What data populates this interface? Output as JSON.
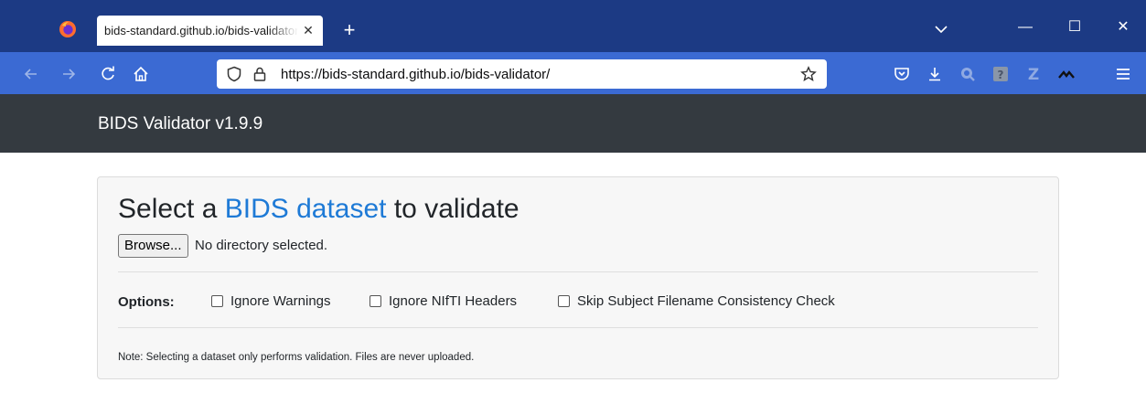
{
  "browser": {
    "tab_title": "bids-standard.github.io/bids-validator/",
    "url_host": "https://bids-standard.github.io",
    "url_path": "/bids-validator/"
  },
  "app": {
    "brand": "BIDS Validator v1.9.9"
  },
  "main": {
    "title_prefix": "Select a ",
    "title_link": "BIDS dataset",
    "title_suffix": " to validate",
    "browse_label": "Browse...",
    "browse_status": "No directory selected.",
    "options_label": "Options:",
    "options": [
      {
        "label": "Ignore Warnings",
        "checked": false
      },
      {
        "label": "Ignore NIfTI Headers",
        "checked": false
      },
      {
        "label": "Skip Subject Filename Consistency Check",
        "checked": false
      }
    ],
    "note": "Note: Selecting a dataset only performs validation. Files are never uploaded."
  },
  "colors": {
    "tabbar": "#1c3a84",
    "navbar": "#3b6ad3",
    "header": "#343a40",
    "link": "#1e7ad6"
  }
}
